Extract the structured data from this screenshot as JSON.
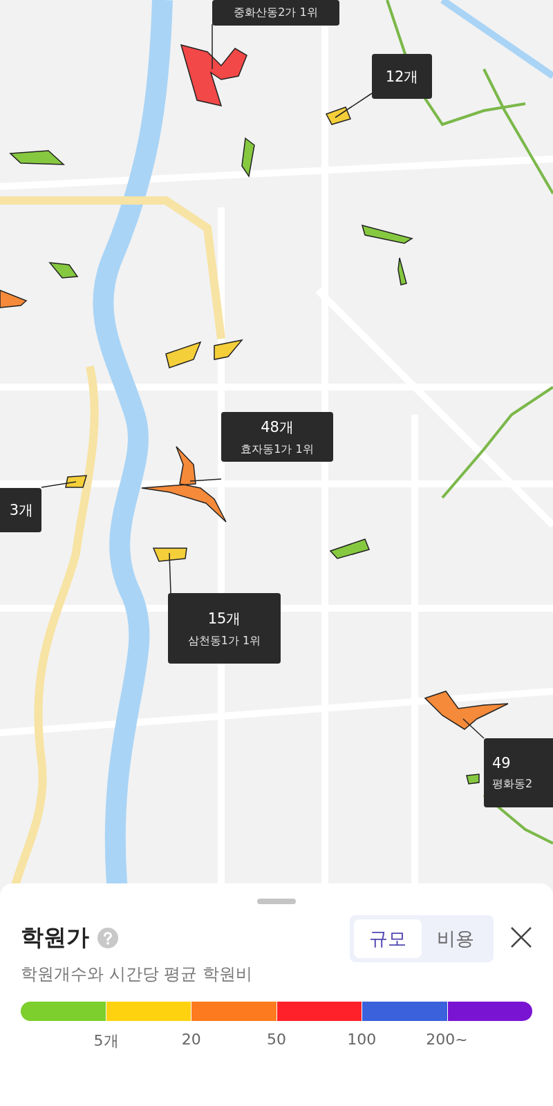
{
  "map": {
    "regions": [
      {
        "color": "#f24848"
      },
      {
        "color": "#f5cf3a"
      },
      {
        "color": "#86c940"
      },
      {
        "color": "#86c940"
      },
      {
        "color": "#86c940"
      },
      {
        "color": "#86c940"
      },
      {
        "color": "#86c940"
      },
      {
        "color": "#f58a3a"
      },
      {
        "color": "#f5cf3a"
      },
      {
        "color": "#f5cf3a"
      },
      {
        "color": "#f5cf3a"
      },
      {
        "color": "#f58a3a"
      },
      {
        "color": "#f5cf3a"
      },
      {
        "color": "#86c940"
      },
      {
        "color": "#f58a3a"
      },
      {
        "color": "#86c940"
      }
    ],
    "callouts": [
      {
        "subtitle": "중화산동2가 1위"
      },
      {
        "count": "12개"
      },
      {
        "count": "48개",
        "subtitle": "효자동1가 1위"
      },
      {
        "count": "3개"
      },
      {
        "count": "15개",
        "subtitle": "삼천동1가 1위"
      },
      {
        "count": "49",
        "subtitle": "평화동2"
      }
    ]
  },
  "sheet": {
    "title": "학원가",
    "subtitle": "학원개수와 시간당 평균 학원비",
    "toggle": [
      {
        "label": "규모",
        "selected": true
      },
      {
        "label": "비용",
        "selected": false
      }
    ],
    "legend": {
      "segments": [
        {
          "color": "#7ccf2c"
        },
        {
          "color": "#ffd20f"
        },
        {
          "color": "#fd7b1e"
        },
        {
          "color": "#fe2129"
        },
        {
          "color": "#3b61dc"
        },
        {
          "color": "#7a14d3"
        }
      ],
      "ticks": [
        "5개",
        "20",
        "50",
        "100",
        "200~"
      ]
    }
  }
}
